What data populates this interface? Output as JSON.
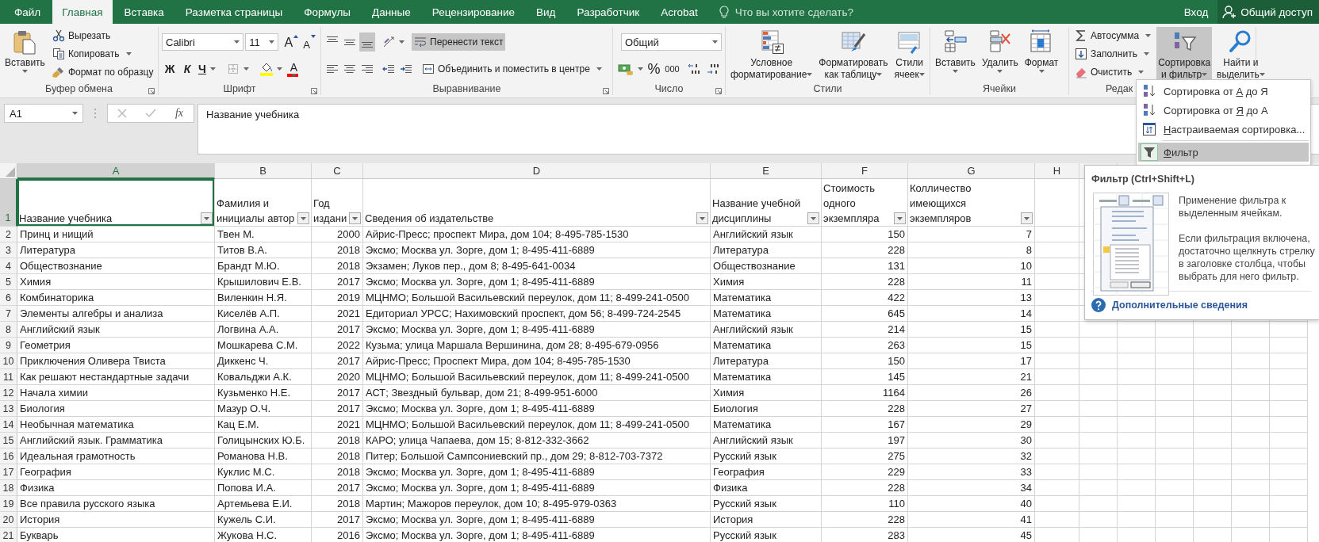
{
  "tabs": [
    {
      "label": "Файл",
      "selected": false
    },
    {
      "label": "Главная",
      "selected": true
    },
    {
      "label": "Вставка",
      "selected": false
    },
    {
      "label": "Разметка страницы",
      "selected": false
    },
    {
      "label": "Формулы",
      "selected": false
    },
    {
      "label": "Данные",
      "selected": false
    },
    {
      "label": "Рецензирование",
      "selected": false
    },
    {
      "label": "Вид",
      "selected": false
    },
    {
      "label": "Разработчик",
      "selected": false
    },
    {
      "label": "Acrobat",
      "selected": false
    }
  ],
  "tell_me": {
    "placeholder": "Что вы хотите сделать?"
  },
  "sign_in": "Вход",
  "share": "Общий доступ",
  "ribbon": {
    "groups": [
      {
        "label": "Буфер обмена",
        "launcher": true,
        "columns": [
          [
            {
              "kind": "large",
              "lines": [
                "Вставить"
              ],
              "dropdown": true,
              "on": false
            }
          ],
          [
            {
              "kind": "small",
              "label": "Вырезать",
              "dropdown": false,
              "on": false
            },
            {
              "kind": "small",
              "label": "Копировать",
              "dropdown": true,
              "on": false
            },
            {
              "kind": "small",
              "label": "Формат по образцу",
              "dropdown": false,
              "on": false
            }
          ]
        ]
      },
      {
        "label": "Шрифт",
        "launcher": true,
        "lines": [
          {
            "controls": [
              {
                "kind": "combo",
                "value": "Calibri"
              },
              {
                "kind": "combo",
                "value": "11"
              },
              {
                "kind": "tool",
                "label": "A",
                "dropdown": false,
                "on": false
              },
              {
                "kind": "tool",
                "label": "A",
                "dropdown": false,
                "on": false
              }
            ]
          },
          {
            "controls": [
              {
                "kind": "tool",
                "label": "Ж",
                "dropdown": false,
                "on": false
              },
              {
                "kind": "tool",
                "label": "К",
                "dropdown": false,
                "on": false
              },
              {
                "kind": "tool",
                "label": "Ч",
                "dropdown": true,
                "on": false
              },
              {
                "kind": "tool",
                "dropdown": true,
                "on": false
              },
              {
                "kind": "tool",
                "dropdown": true,
                "on": false
              },
              {
                "kind": "tool",
                "label": "A",
                "dropdown": true,
                "on": false
              }
            ]
          }
        ]
      },
      {
        "label": "Выравнивание",
        "launcher": true,
        "lines": [
          {
            "controls": [
              {
                "kind": "tool",
                "dropdown": false,
                "on": false
              },
              {
                "kind": "tool",
                "dropdown": false,
                "on": false
              },
              {
                "kind": "tool",
                "dropdown": false,
                "on": true
              },
              {
                "kind": "tool",
                "dropdown": true,
                "on": false
              },
              {
                "kind": "small",
                "label": "Перенести текст",
                "dropdown": false,
                "on": true
              }
            ]
          },
          {
            "controls": [
              {
                "kind": "tool",
                "dropdown": false,
                "on": false
              },
              {
                "kind": "tool",
                "dropdown": false,
                "on": false
              },
              {
                "kind": "tool",
                "dropdown": false,
                "on": false
              },
              {
                "kind": "tool",
                "dropdown": false,
                "on": false
              },
              {
                "kind": "tool",
                "dropdown": false,
                "on": false
              },
              {
                "kind": "small",
                "label": "Объединить и поместить в центре",
                "dropdown": true,
                "on": false
              }
            ]
          }
        ]
      },
      {
        "label": "Число",
        "launcher": true,
        "lines": [
          {
            "controls": [
              {
                "kind": "combo",
                "value": "Общий"
              }
            ]
          },
          {
            "controls": [
              {
                "kind": "tool",
                "dropdown": true,
                "on": false
              },
              {
                "kind": "tool",
                "label": "%",
                "dropdown": false,
                "on": false
              },
              {
                "kind": "tool",
                "label": "000",
                "dropdown": false,
                "on": false
              },
              {
                "kind": "tool",
                "dropdown": false,
                "on": false
              },
              {
                "kind": "tool",
                "dropdown": false,
                "on": false
              }
            ]
          }
        ]
      },
      {
        "label": "Стили",
        "launcher": false,
        "columns": [
          [
            {
              "kind": "large",
              "lines": [
                "Условное",
                "форматирование"
              ],
              "dropdown": true,
              "on": false
            }
          ],
          [
            {
              "kind": "large",
              "lines": [
                "Форматировать",
                "как таблицу"
              ],
              "dropdown": true,
              "on": false
            }
          ],
          [
            {
              "kind": "large",
              "lines": [
                "Стили",
                "ячеек"
              ],
              "dropdown": true,
              "on": false
            }
          ]
        ]
      },
      {
        "label": "Ячейки",
        "launcher": false,
        "columns": [
          [
            {
              "kind": "large",
              "lines": [
                "Вставить"
              ],
              "dropdown": true,
              "on": false
            }
          ],
          [
            {
              "kind": "large",
              "lines": [
                "Удалить"
              ],
              "dropdown": true,
              "on": false
            }
          ],
          [
            {
              "kind": "large",
              "lines": [
                "Формат"
              ],
              "dropdown": true,
              "on": false
            }
          ]
        ]
      },
      {
        "label": "Редак",
        "launcher": false,
        "columns": [
          [
            {
              "kind": "small",
              "label": "Автосумма",
              "dropdown": true,
              "on": false
            },
            {
              "kind": "small",
              "label": "Заполнить",
              "dropdown": true,
              "on": false
            },
            {
              "kind": "small",
              "label": "Очистить",
              "dropdown": true,
              "on": false
            }
          ],
          [
            {
              "kind": "large",
              "lines": [
                "Сортировка",
                "и фильтр"
              ],
              "dropdown": true,
              "on": true
            }
          ],
          [
            {
              "kind": "large",
              "lines": [
                "Найти и",
                "выделить"
              ],
              "dropdown": true,
              "on": false
            }
          ]
        ]
      }
    ]
  },
  "sort_menu": {
    "items": [
      {
        "before": "Сортировка от ",
        "key": "А",
        "after": " до Я",
        "separator_before": false,
        "selected": false
      },
      {
        "before": "Сортировка от ",
        "key": "Я",
        "after": " до А",
        "separator_before": false,
        "selected": false
      },
      {
        "key": "Н",
        "after": "астраиваемая сортировка...",
        "separator_before": false,
        "selected": false
      },
      {
        "key": "Ф",
        "after": "ильтр",
        "separator_before": true,
        "selected": true
      }
    ]
  },
  "tooltip": {
    "title": "Фильтр (Ctrl+Shift+L)",
    "paragraphs": [
      "Применение фильтра к выделенным ячейкам.",
      "Если фильтрация включена, достаточно щелкнуть стрелку в заголовке столбца, чтобы выбрать для него фильтр."
    ],
    "link": "Дополнительные сведения"
  },
  "formula_bar": {
    "name_box": "A1",
    "function_button": "fx",
    "formula": "Название учебника"
  },
  "sheet": {
    "columns": [
      {
        "label": "A",
        "selected": true
      },
      {
        "label": "B",
        "selected": false
      },
      {
        "label": "C",
        "selected": false
      },
      {
        "label": "D",
        "selected": false
      },
      {
        "label": "E",
        "selected": false
      },
      {
        "label": "F",
        "selected": false
      },
      {
        "label": "G",
        "selected": false
      },
      {
        "label": "H",
        "selected": false
      }
    ],
    "header_row": {
      "number": "1",
      "selected": true,
      "cells": [
        "Название учебника",
        "Фамилия и инициалы автор",
        "Год издани",
        "Сведения об издательстве",
        "Название учебной дисциплины",
        "Стоимость одного экземпляра",
        "Колличество имеющихся экземпляров"
      ]
    },
    "rows": [
      {
        "number": "2",
        "selected": false,
        "cells": [
          "Принц и нищий",
          "Твен М.",
          "2000",
          "Айрис-Пресс; проспект Мира, дом 104; 8-495-785-1530",
          "Английский язык",
          "150",
          "7"
        ]
      },
      {
        "number": "3",
        "selected": false,
        "cells": [
          "Литература",
          "Титов В.А.",
          "2018",
          "Эксмо; Москва ул. Зорге, дом 1; 8-495-411-6889",
          "Литература",
          "228",
          "8"
        ]
      },
      {
        "number": "4",
        "selected": false,
        "cells": [
          "Обществознание",
          "Брандт М.Ю.",
          "2018",
          "Экзамен; Луков пер., дом 8; 8-495-641-0034",
          "Обществознание",
          "131",
          "10"
        ]
      },
      {
        "number": "5",
        "selected": false,
        "cells": [
          "Химия",
          "Крышилович Е.В.",
          "2017",
          "Эксмо; Москва ул. Зорге, дом 1; 8-495-411-6889",
          "Химия",
          "228",
          "11"
        ]
      },
      {
        "number": "6",
        "selected": false,
        "cells": [
          "Комбинаторика",
          "Виленкин Н.Я.",
          "2019",
          "МЦНМО; Большой Васильевский переулок, дом 11; 8-499-241-0500",
          "Математика",
          "422",
          "13"
        ]
      },
      {
        "number": "7",
        "selected": false,
        "cells": [
          "Элементы алгебры и анализа",
          "Киселёв А.П.",
          "2021",
          "Едиториал УРСС; Нахимовский проспект, дом 56; 8-499-724-2545",
          "Математика",
          "645",
          "14"
        ]
      },
      {
        "number": "8",
        "selected": false,
        "cells": [
          "Английский язык",
          "Логвина А.А.",
          "2017",
          "Эксмо; Москва ул. Зорге, дом 1; 8-495-411-6889",
          "Английский язык",
          "214",
          "15"
        ]
      },
      {
        "number": "9",
        "selected": false,
        "cells": [
          "Геометрия",
          "Мошкарева С.М.",
          "2022",
          "Кузьма; улица Маршала Вершинина, дом 28; 8-495-679-0956",
          "Математика",
          "263",
          "15"
        ]
      },
      {
        "number": "10",
        "selected": false,
        "cells": [
          "Приключения Оливера Твиста",
          "Диккенс Ч.",
          "2017",
          "Айрис-Пресс; Проспект Мира, дом 104; 8-495-785-1530",
          "Литература",
          "150",
          "17"
        ]
      },
      {
        "number": "11",
        "selected": false,
        "cells": [
          "Как решают нестандартные задачи",
          "Ковальджи А.К.",
          "2020",
          "МЦНМО; Большой Васильевский переулок, дом 11; 8-499-241-0500",
          "Математика",
          "145",
          "21"
        ]
      },
      {
        "number": "12",
        "selected": false,
        "cells": [
          "Начала химии",
          "Кузьменко Н.Е.",
          "2017",
          "АСТ; Звездный бульвар, дом 21; 8-499-951-6000",
          "Химия",
          "1164",
          "26"
        ]
      },
      {
        "number": "13",
        "selected": false,
        "cells": [
          "Биология",
          "Мазур О.Ч.",
          "2017",
          "Эксмо; Москва ул. Зорге, дом 1; 8-495-411-6889",
          "Биология",
          "228",
          "27"
        ]
      },
      {
        "number": "14",
        "selected": false,
        "cells": [
          "Необычная математика",
          "Кац Е.М.",
          "2021",
          "МЦНМО; Большой Васильевский переулок, дом 11; 8-499-241-0500",
          "Математика",
          "167",
          "29"
        ]
      },
      {
        "number": "15",
        "selected": false,
        "cells": [
          "Английский язык. Грамматика",
          "Голицынских Ю.Б.",
          "2018",
          "КАРО; улица Чапаева, дом 15; 8-812-332-3662",
          "Английский язык",
          "197",
          "30"
        ]
      },
      {
        "number": "16",
        "selected": false,
        "cells": [
          "Идеальная грамотность",
          "Романова Н.В.",
          "2018",
          "Питер; Большой Сампсониевский пр., дом 29; 8-812-703-7372",
          "Русский язык",
          "275",
          "32"
        ]
      },
      {
        "number": "17",
        "selected": false,
        "cells": [
          "География",
          "Куклис М.С.",
          "2018",
          "Эксмо; Москва ул. Зорге, дом 1; 8-495-411-6889",
          "География",
          "229",
          "33"
        ]
      },
      {
        "number": "18",
        "selected": false,
        "cells": [
          "Физика",
          "Попова И.А.",
          "2017",
          "Эксмо; Москва ул. Зорге, дом 1; 8-495-411-6889",
          "Физика",
          "228",
          "34"
        ]
      },
      {
        "number": "19",
        "selected": false,
        "cells": [
          "Все правила русского языка",
          "Артемьева Е.И.",
          "2018",
          "Мартин; Мажоров переулок, дом 10; 8-495-979-0363",
          "Русский язык",
          "110",
          "40"
        ]
      },
      {
        "number": "20",
        "selected": false,
        "cells": [
          "История",
          "Кужель С.И.",
          "2017",
          "Эксмо; Москва ул. Зорге, дом 1; 8-495-411-6889",
          "История",
          "228",
          "41"
        ]
      },
      {
        "number": "21",
        "selected": false,
        "cells": [
          "Букварь",
          "Жукова Н.С.",
          "2016",
          "Эксмо; Москва ул. Зорге, дом 1; 8-495-411-6889",
          "Русский язык",
          "283",
          "45"
        ]
      }
    ]
  }
}
